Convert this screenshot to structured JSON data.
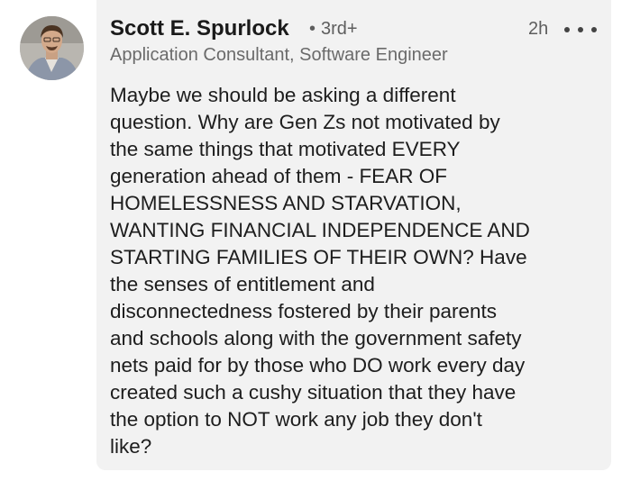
{
  "comment": {
    "author": "Scott E. Spurlock",
    "connection_separator": "•",
    "connection_degree": "3rd+",
    "time_ago": "2h",
    "headline": "Application Consultant, Software Engineer",
    "text": "Maybe we should be asking a different\nquestion. Why are Gen Zs not motivated by\nthe same things that motivated EVERY\ngeneration ahead of them - FEAR OF\nHOMELESSNESS AND STARVATION,\nWANTING FINANCIAL INDEPENDENCE AND\nSTARTING FAMILIES OF THEIR OWN? Have\nthe senses of entitlement and\ndisconnectedness fostered by their parents\nand schools along with the government safety\nnets paid for by those who DO work every day\ncreated such a cushy situation that they have\nthe option to NOT work any job they don't\nlike?"
  },
  "icons": {
    "more": "more-options-icon",
    "avatar": "profile-photo"
  },
  "colors": {
    "bubble_background": "#f2f2f2",
    "name": "#1a1a1a",
    "secondary_text": "#5e5e5e",
    "body_text": "#1d1d1d"
  }
}
